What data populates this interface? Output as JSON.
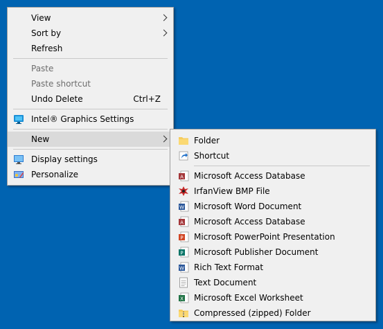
{
  "context_menu": {
    "items": [
      {
        "label": "View",
        "submenu": true
      },
      {
        "label": "Sort by",
        "submenu": true
      },
      {
        "label": "Refresh"
      },
      {
        "label": "Paste",
        "disabled": true
      },
      {
        "label": "Paste shortcut",
        "disabled": true
      },
      {
        "label": "Undo Delete",
        "shortcut": "Ctrl+Z"
      },
      {
        "label": "Intel® Graphics Settings",
        "icon": "intel-graphics-icon"
      },
      {
        "label": "New",
        "submenu": true
      },
      {
        "label": "Display settings",
        "icon": "display-icon"
      },
      {
        "label": "Personalize",
        "icon": "personalize-icon"
      }
    ]
  },
  "new_submenu": {
    "items": [
      {
        "label": "Folder",
        "icon": "folder-icon"
      },
      {
        "label": "Shortcut",
        "icon": "shortcut-icon"
      },
      {
        "label": "Microsoft Access Database",
        "icon": "access-icon"
      },
      {
        "label": "IrfanView BMP File",
        "icon": "irfanview-icon"
      },
      {
        "label": "Microsoft Word Document",
        "icon": "word-icon"
      },
      {
        "label": "Microsoft Access Database",
        "icon": "access-icon"
      },
      {
        "label": "Microsoft PowerPoint Presentation",
        "icon": "powerpoint-icon"
      },
      {
        "label": "Microsoft Publisher Document",
        "icon": "publisher-icon"
      },
      {
        "label": "Rich Text Format",
        "icon": "rtf-icon"
      },
      {
        "label": "Text Document",
        "icon": "text-document-icon"
      },
      {
        "label": "Microsoft Excel Worksheet",
        "icon": "excel-icon"
      },
      {
        "label": "Compressed (zipped) Folder",
        "icon": "zip-folder-icon"
      }
    ]
  },
  "colors": {
    "desktop": "#0063b1",
    "menu_bg": "#f0f0f0",
    "hover": "#dadada"
  }
}
